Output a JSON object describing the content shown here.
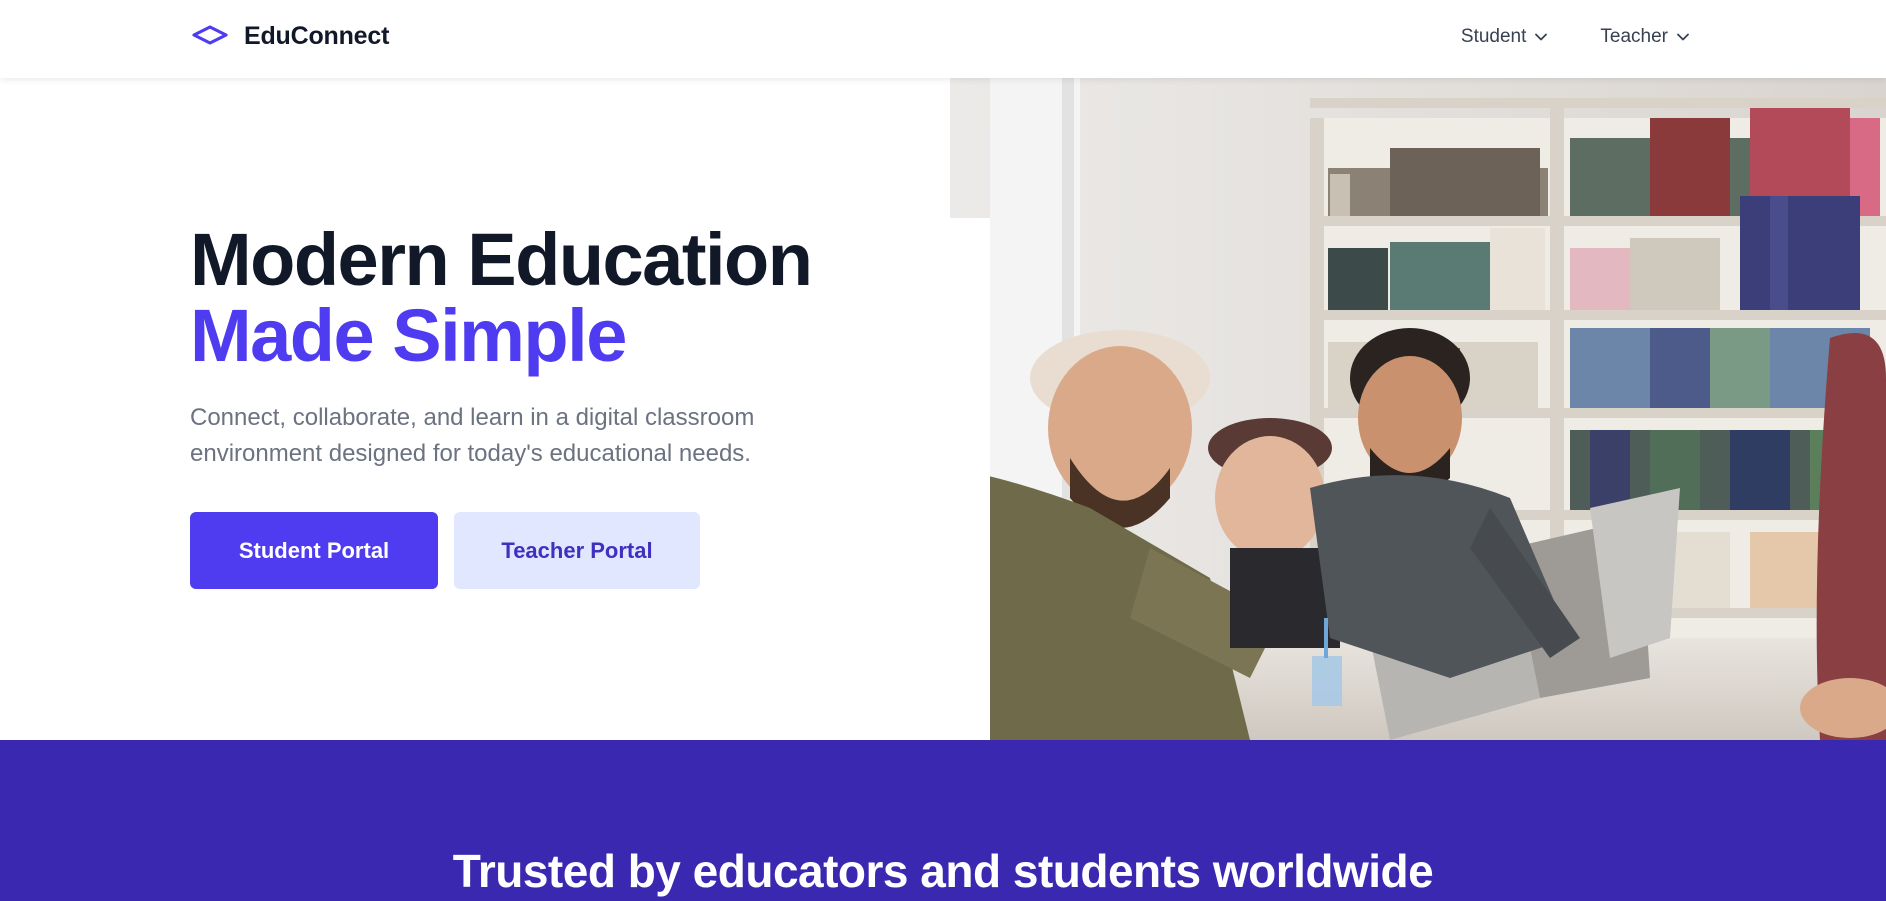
{
  "brand": {
    "name": "EduConnect",
    "logo_icon": "diamond-logo-icon",
    "accent_color": "#4f3bf0"
  },
  "nav": {
    "items": [
      {
        "label": "Student",
        "icon": "chevron-down-icon"
      },
      {
        "label": "Teacher",
        "icon": "chevron-down-icon"
      }
    ]
  },
  "hero": {
    "title_line1": "Modern Education",
    "title_line2": "Made Simple",
    "subtitle": "Connect, collaborate, and learn in a digital classroom environment designed for today's educational needs.",
    "primary_button": "Student Portal",
    "secondary_button": "Teacher Portal",
    "image": "students-laughing-at-laptop-in-library-photo"
  },
  "band": {
    "title": "Trusted by educators and students worldwide",
    "background_color": "#3a29b0"
  }
}
